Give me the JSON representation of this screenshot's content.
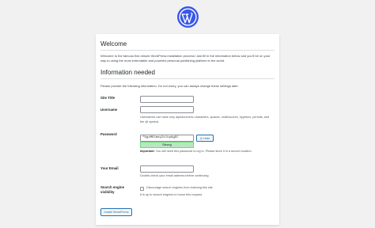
{
  "logo": {
    "icon": "wordpress-logo-icon",
    "color": "#3858e9"
  },
  "welcome": {
    "title": "Welcome",
    "text": "Welcome to the famous five-minute WordPress installation process! Just fill in the information below and you’ll be on your way to using the most extendable and powerful personal publishing platform in the world."
  },
  "info": {
    "title": "Information needed",
    "text": "Please provide the following information. Do not worry, you can always change these settings later."
  },
  "form": {
    "site_title": {
      "label": "Site Title",
      "value": ""
    },
    "username": {
      "label": "Username",
      "value": "",
      "description": "Usernames can have only alphanumeric characters, spaces, underscores, hyphens, periods, and the @ symbol."
    },
    "password": {
      "label": "Password",
      "value": "^8gxM8lmeyZolkpAgDC",
      "hide_label": "Hide",
      "strength": "Strong",
      "important_label": "Important:",
      "important_text": "You will need this password to log in. Please store it in a secure location."
    },
    "email": {
      "label": "Your Email",
      "value": "",
      "description": "Double-check your email address before continuing."
    },
    "search_visibility": {
      "label": "Search engine visibility",
      "checkbox_label": "Discourage search engines from indexing this site",
      "checked": false,
      "description": "It is up to search engines to honor this request."
    }
  },
  "install_button": "Install WordPress",
  "colors": {
    "accent": "#2271b1",
    "strength_bg": "#b8e6bf",
    "background": "#f1f1f1"
  }
}
